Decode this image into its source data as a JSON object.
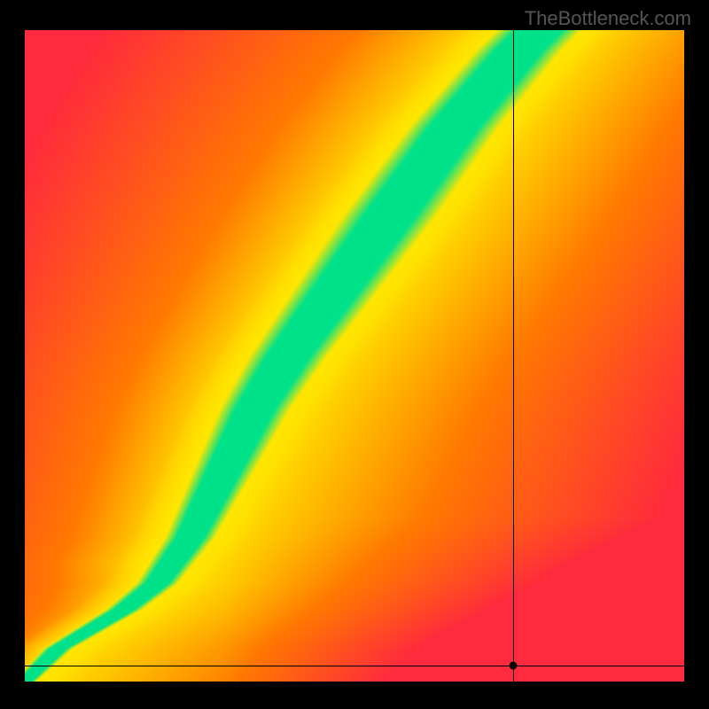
{
  "watermark": "TheBottleneck.com",
  "chart_data": {
    "type": "heatmap",
    "title": "",
    "xlabel": "",
    "ylabel": "",
    "xlim": [
      0,
      1
    ],
    "ylim": [
      0,
      1
    ],
    "marker": {
      "x": 0.74,
      "y": 0.025
    },
    "optimal_curve": [
      {
        "x": 0.0,
        "y": 0.0
      },
      {
        "x": 0.05,
        "y": 0.05
      },
      {
        "x": 0.1,
        "y": 0.08
      },
      {
        "x": 0.15,
        "y": 0.11
      },
      {
        "x": 0.2,
        "y": 0.15
      },
      {
        "x": 0.25,
        "y": 0.22
      },
      {
        "x": 0.3,
        "y": 0.32
      },
      {
        "x": 0.35,
        "y": 0.42
      },
      {
        "x": 0.4,
        "y": 0.5
      },
      {
        "x": 0.45,
        "y": 0.57
      },
      {
        "x": 0.5,
        "y": 0.64
      },
      {
        "x": 0.55,
        "y": 0.71
      },
      {
        "x": 0.6,
        "y": 0.78
      },
      {
        "x": 0.65,
        "y": 0.85
      },
      {
        "x": 0.7,
        "y": 0.91
      },
      {
        "x": 0.75,
        "y": 0.97
      },
      {
        "x": 0.78,
        "y": 1.0
      }
    ],
    "colors": {
      "low": "#ff2a3d",
      "mid": "#ffe600",
      "optimal": "#00e28a",
      "high": "#ff7a00"
    }
  }
}
